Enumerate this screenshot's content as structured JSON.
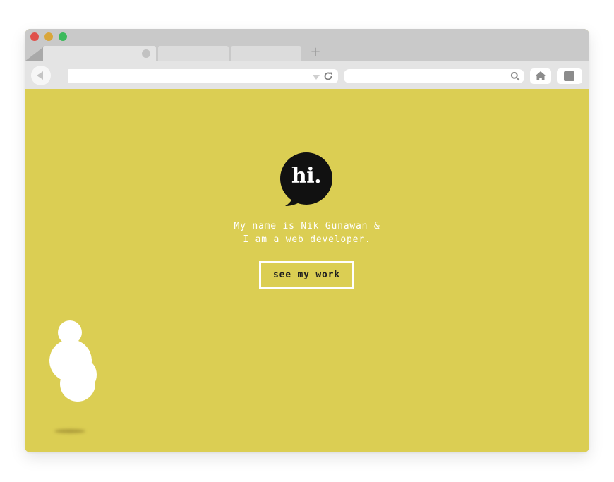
{
  "browser": {
    "window_controls": [
      {
        "name": "close",
        "color": "#e0514b"
      },
      {
        "name": "minimize",
        "color": "#d9a63a"
      },
      {
        "name": "maximize",
        "color": "#3dba5c"
      }
    ],
    "new_tab_label": "+",
    "url": {
      "value": ""
    },
    "search": {
      "value": ""
    }
  },
  "page": {
    "background_color": "#dbce53",
    "logo_text": "hi.",
    "intro_line1": "My name is Nik Gunawan &",
    "intro_line2": "I am a web developer.",
    "cta_label": "see my work"
  }
}
